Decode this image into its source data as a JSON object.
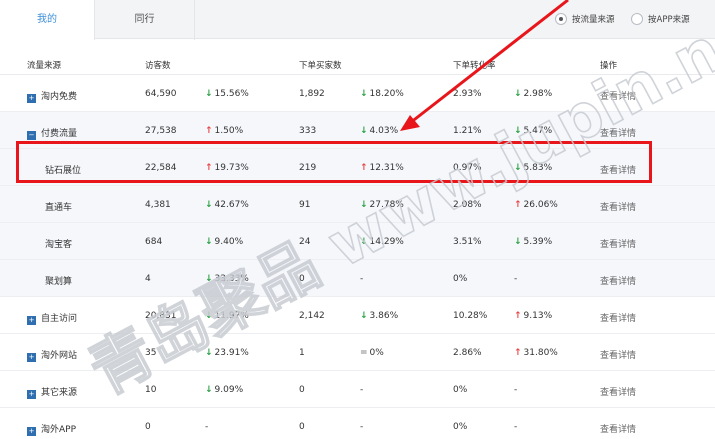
{
  "tabs": {
    "mine": "我的",
    "peers": "同行"
  },
  "filters": {
    "by_source": "按流量来源",
    "by_app": "按APP来源"
  },
  "columns": [
    "流量来源",
    "访客数",
    "下单买家数",
    "下单转化率",
    "操作"
  ],
  "rows": [
    {
      "name": "淘内免费",
      "icon": "plus",
      "visitors": "64,590",
      "v_change": "15.56%",
      "v_dir": "down",
      "buyers": "1,892",
      "b_change": "18.20%",
      "b_dir": "down",
      "rate": "2.93%",
      "r_change": "2.98%",
      "r_dir": "down",
      "action": "查看详情"
    },
    {
      "name": "付费流量",
      "icon": "minus",
      "visitors": "27,538",
      "v_change": "1.50%",
      "v_dir": "up",
      "buyers": "333",
      "b_change": "4.03%",
      "b_dir": "down",
      "rate": "1.21%",
      "r_change": "5.47%",
      "r_dir": "down",
      "action": "查看详情"
    },
    {
      "name": "钻石展位",
      "icon": "",
      "visitors": "22,584",
      "v_change": "19.73%",
      "v_dir": "up",
      "buyers": "219",
      "b_change": "12.31%",
      "b_dir": "up",
      "rate": "0.97%",
      "r_change": "5.83%",
      "r_dir": "down",
      "action": "查看详情"
    },
    {
      "name": "直通车",
      "icon": "",
      "visitors": "4,381",
      "v_change": "42.67%",
      "v_dir": "down",
      "buyers": "91",
      "b_change": "27.78%",
      "b_dir": "down",
      "rate": "2.08%",
      "r_change": "26.06%",
      "r_dir": "up",
      "action": "查看详情"
    },
    {
      "name": "淘宝客",
      "icon": "",
      "visitors": "684",
      "v_change": "9.40%",
      "v_dir": "down",
      "buyers": "24",
      "b_change": "14.29%",
      "b_dir": "down",
      "rate": "3.51%",
      "r_change": "5.39%",
      "r_dir": "down",
      "action": "查看详情"
    },
    {
      "name": "聚划算",
      "icon": "",
      "visitors": "4",
      "v_change": "33.33%",
      "v_dir": "down",
      "buyers": "0",
      "b_change": "-",
      "b_dir": "none",
      "rate": "0%",
      "r_change": "-",
      "r_dir": "none",
      "action": "查看详情"
    },
    {
      "name": "自主访问",
      "icon": "plus",
      "visitors": "20,831",
      "v_change": "11.97%",
      "v_dir": "down",
      "buyers": "2,142",
      "b_change": "3.86%",
      "b_dir": "down",
      "rate": "10.28%",
      "r_change": "9.13%",
      "r_dir": "up",
      "action": "查看详情"
    },
    {
      "name": "淘外网站",
      "icon": "plus",
      "visitors": "35",
      "v_change": "23.91%",
      "v_dir": "down",
      "buyers": "1",
      "b_change": "0%",
      "b_dir": "flat",
      "rate": "2.86%",
      "r_change": "31.80%",
      "r_dir": "up",
      "action": "查看详情"
    },
    {
      "name": "其它来源",
      "icon": "plus",
      "visitors": "10",
      "v_change": "9.09%",
      "v_dir": "down",
      "buyers": "0",
      "b_change": "-",
      "b_dir": "none",
      "rate": "0%",
      "r_change": "-",
      "r_dir": "none",
      "action": "查看详情"
    },
    {
      "name": "淘外APP",
      "icon": "plus",
      "visitors": "0",
      "v_change": "-",
      "v_dir": "none",
      "buyers": "0",
      "b_change": "-",
      "b_dir": "none",
      "rate": "0%",
      "r_change": "-",
      "r_dir": "none",
      "action": "查看详情"
    }
  ],
  "watermark": "青岛聚品 www.jupin.net.cn",
  "colors": {
    "up": "#e84545",
    "down": "#2aa244",
    "link": "#3d8fd9",
    "highlight": "#e8161b"
  }
}
